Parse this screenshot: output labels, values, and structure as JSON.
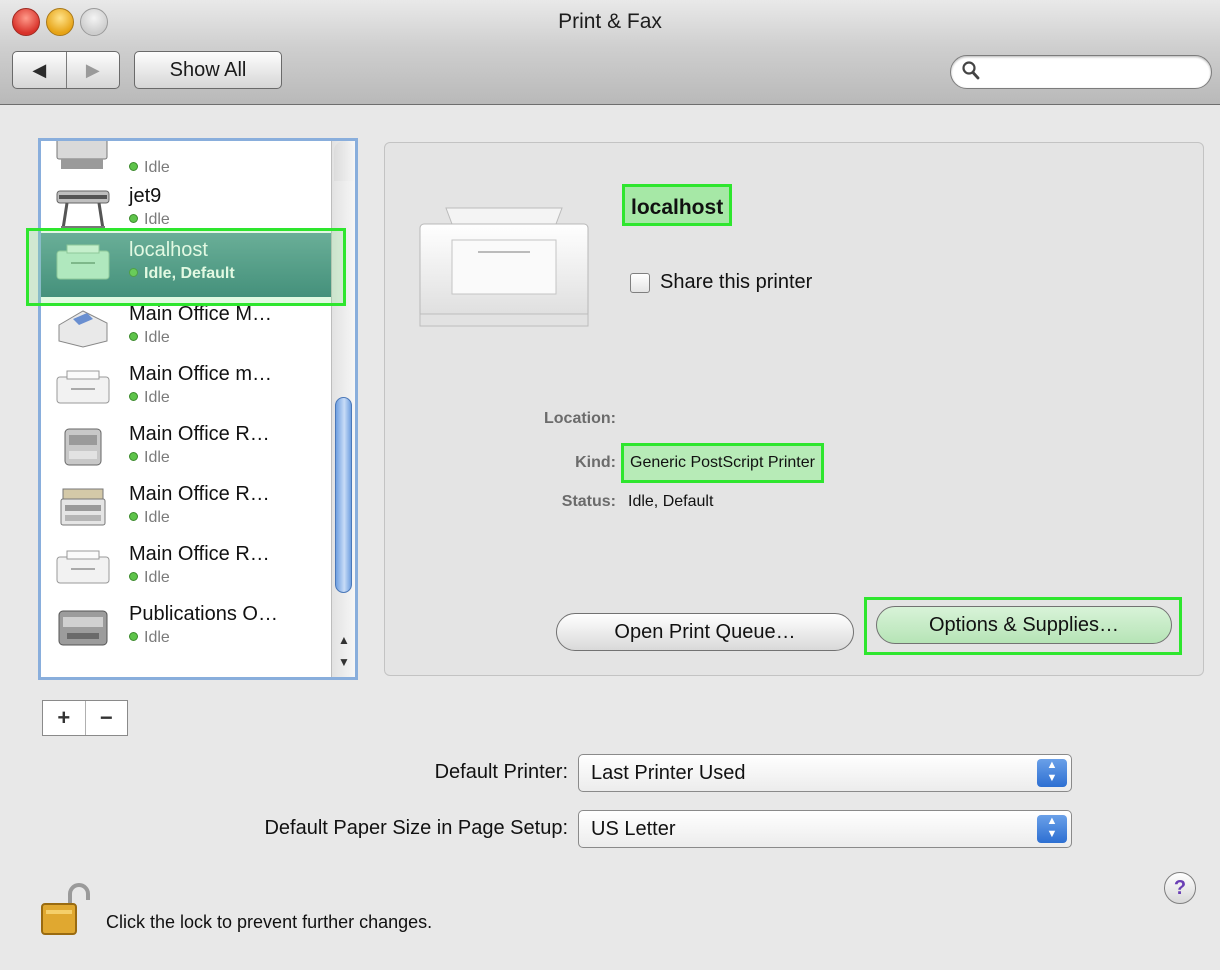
{
  "window": {
    "title": "Print & Fax"
  },
  "toolbar": {
    "back_glyph": "◀",
    "forward_glyph": "▶",
    "show_all_label": "Show All",
    "search_placeholder": "",
    "search_icon": "magnifier-icon"
  },
  "printers": [
    {
      "name": "",
      "status": "Idle",
      "icon": "wide-printer-icon"
    },
    {
      "name": "jet9",
      "status": "Idle",
      "icon": "plotter-icon"
    },
    {
      "name": "localhost",
      "status": "Idle, Default",
      "icon": "laser-printer-icon",
      "selected": true
    },
    {
      "name": "Main Office M…",
      "status": "Idle",
      "icon": "inkjet-printer-icon"
    },
    {
      "name": "Main Office m…",
      "status": "Idle",
      "icon": "laser-printer-icon"
    },
    {
      "name": "Main Office R…",
      "status": "Idle",
      "icon": "office-printer-icon"
    },
    {
      "name": "Main Office R…",
      "status": "Idle",
      "icon": "multifunction-printer-icon"
    },
    {
      "name": "Main Office R…",
      "status": "Idle",
      "icon": "laser-printer-icon"
    },
    {
      "name": "Publications O…",
      "status": "Idle",
      "icon": "workgroup-printer-icon"
    }
  ],
  "list_controls": {
    "add_label": "+",
    "remove_label": "−"
  },
  "detail": {
    "printer_name": "localhost",
    "share_label": "Share this printer",
    "share_checked": false,
    "location_label": "Location:",
    "location_value": "",
    "kind_label": "Kind:",
    "kind_value": "Generic PostScript Printer",
    "status_label": "Status:",
    "status_value": "Idle, Default",
    "open_queue_label": "Open Print Queue…",
    "options_label": "Options & Supplies…"
  },
  "defaults": {
    "default_printer_label": "Default Printer:",
    "default_printer_value": "Last Printer Used",
    "paper_size_label": "Default Paper Size in Page Setup:",
    "paper_size_value": "US Letter"
  },
  "footer": {
    "lock_text": "Click the lock to prevent further changes.",
    "help_label": "?"
  },
  "colors": {
    "highlight_green": "#2ee62e",
    "selection_teal": "#2d7476",
    "status_dot": "#5ec34a"
  }
}
